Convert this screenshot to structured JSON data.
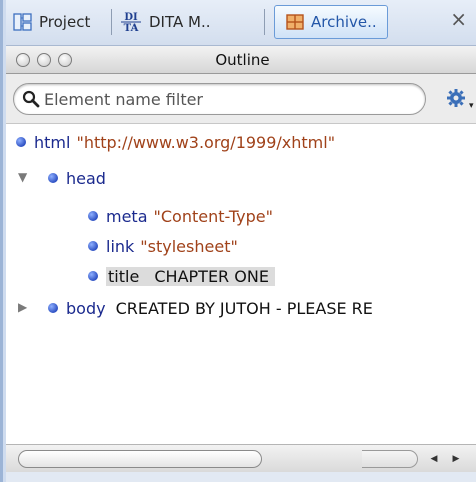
{
  "tabs": [
    {
      "label": "Project",
      "icon": "project-icon",
      "active": false
    },
    {
      "label": "DITA M..",
      "icon": "dita-icon",
      "icon_text_top": "DI",
      "icon_text_bottom": "TA",
      "active": false
    },
    {
      "label": "Archive..",
      "icon": "archive-icon",
      "active": true
    }
  ],
  "tab_close": "×",
  "window": {
    "title": "Outline"
  },
  "filter": {
    "placeholder": "Element name filter",
    "value": ""
  },
  "tree": [
    {
      "tag": "html",
      "attr": "\"http://www.w3.org/1999/xhtml\"",
      "text": ""
    },
    {
      "tag": "head",
      "attr": "",
      "text": "",
      "expanded": true
    },
    {
      "tag": "meta",
      "attr": "\"Content-Type\"",
      "text": ""
    },
    {
      "tag": "link",
      "attr": "\"stylesheet\"",
      "text": ""
    },
    {
      "tag": "title",
      "attr": "",
      "text": "CHAPTER ONE",
      "selected": true
    },
    {
      "tag": "body",
      "attr": "",
      "text": "CREATED BY JUTOH - PLEASE RE",
      "expanded": false
    }
  ],
  "colors": {
    "tag": "#1b2a8e",
    "attr": "#a0421a",
    "selection": "#dcdcdc",
    "active_tab_border": "#6a9bd8"
  }
}
